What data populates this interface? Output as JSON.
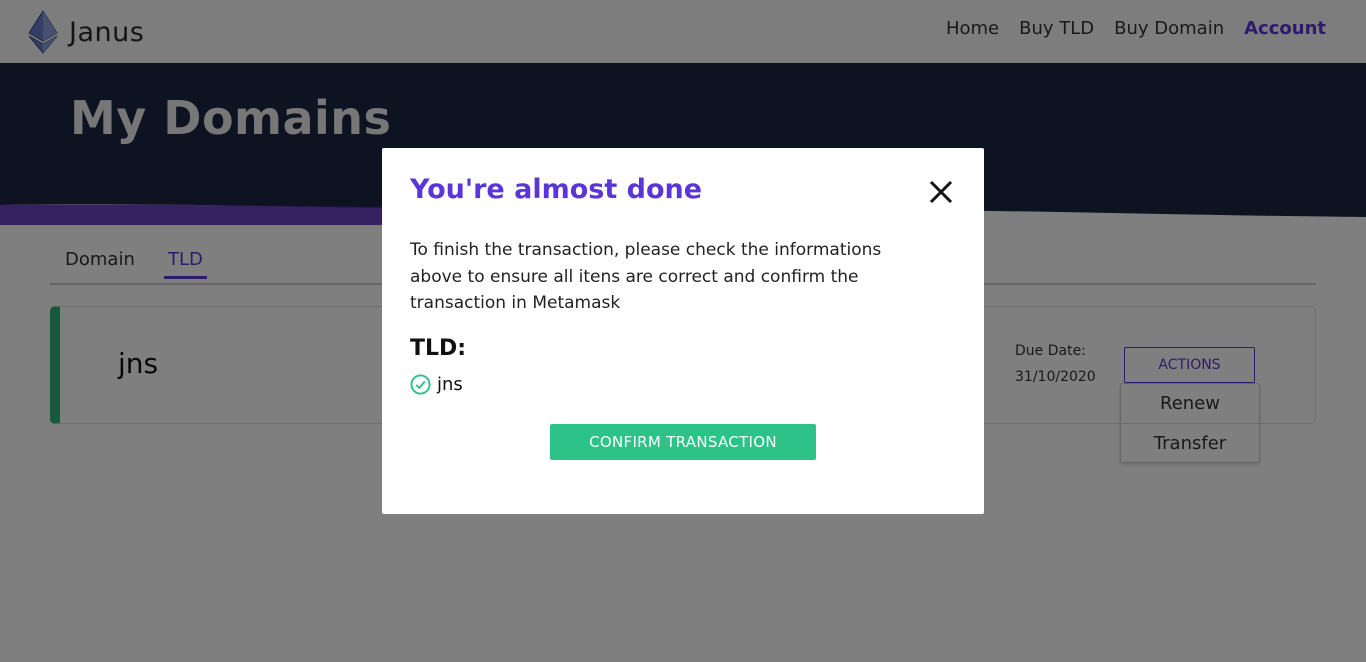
{
  "app": {
    "name": "Janus"
  },
  "nav": {
    "items": [
      "Home",
      "Buy TLD",
      "Buy Domain",
      "Account"
    ],
    "active": "Account"
  },
  "hero": {
    "title": "My Domains"
  },
  "tabs": [
    {
      "label": "Domain"
    },
    {
      "label": "TLD",
      "active": true
    }
  ],
  "card": {
    "name": "jns",
    "due_label": "Due Date:",
    "due_value": "31/10/2020",
    "actions_label": "ACTIONS",
    "menu": [
      "Renew",
      "Transfer"
    ]
  },
  "modal": {
    "title": "You're almost done",
    "body": "To finish the transaction, please check the informations above to ensure all itens are correct and confirm the transaction in Metamask",
    "tld_label": "TLD:",
    "tld_value": "jns",
    "confirm_label": "CONFIRM TRANSACTION"
  },
  "icons": {
    "logo": "ethereum-icon",
    "close": "close-icon",
    "check": "check-circle-icon"
  },
  "colors": {
    "accent": "#5a36d6",
    "success": "#2dc287",
    "hero_bg": "#1c2645",
    "card_stripe": "#2ab57d"
  }
}
